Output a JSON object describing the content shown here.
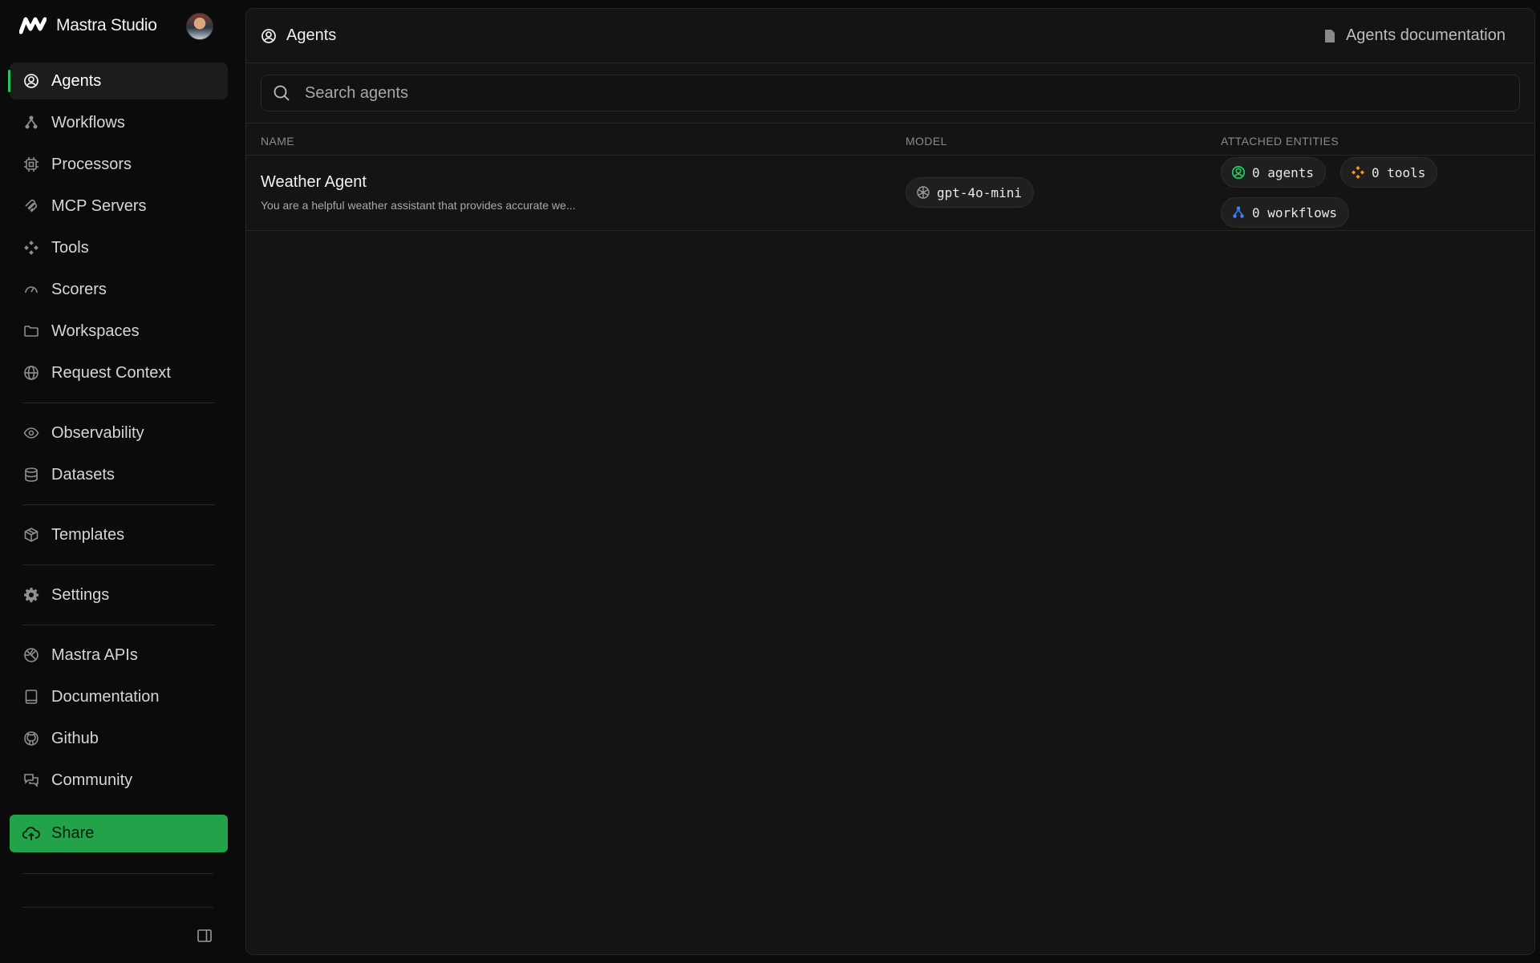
{
  "app": {
    "name": "Mastra Studio"
  },
  "sidebar": {
    "items": [
      {
        "label": "Agents",
        "icon": "agent-icon"
      },
      {
        "label": "Workflows",
        "icon": "workflow-icon"
      },
      {
        "label": "Processors",
        "icon": "processor-icon"
      },
      {
        "label": "MCP Servers",
        "icon": "mcp-icon"
      },
      {
        "label": "Tools",
        "icon": "tools-icon"
      },
      {
        "label": "Scorers",
        "icon": "gauge-icon"
      },
      {
        "label": "Workspaces",
        "icon": "folder-icon"
      },
      {
        "label": "Request Context",
        "icon": "globe-icon"
      },
      {
        "label": "Observability",
        "icon": "eye-icon"
      },
      {
        "label": "Datasets",
        "icon": "database-icon"
      },
      {
        "label": "Templates",
        "icon": "package-icon"
      },
      {
        "label": "Settings",
        "icon": "gear-icon"
      },
      {
        "label": "Mastra APIs",
        "icon": "api-icon"
      },
      {
        "label": "Documentation",
        "icon": "book-icon"
      },
      {
        "label": "Github",
        "icon": "github-icon"
      },
      {
        "label": "Community",
        "icon": "chat-icon"
      }
    ],
    "share_label": "Share",
    "accent": "#22a34a"
  },
  "header": {
    "title": "Agents",
    "doc_link": "Agents documentation"
  },
  "search": {
    "placeholder": "Search agents"
  },
  "table": {
    "columns": [
      "NAME",
      "MODEL",
      "ATTACHED ENTITIES"
    ],
    "rows": [
      {
        "name": "Weather Agent",
        "description": "You are a helpful weather assistant that provides accurate we...",
        "model": "gpt-4o-mini",
        "agents": "0 agents",
        "tools": "0 tools",
        "workflows": "0 workflows"
      }
    ]
  }
}
